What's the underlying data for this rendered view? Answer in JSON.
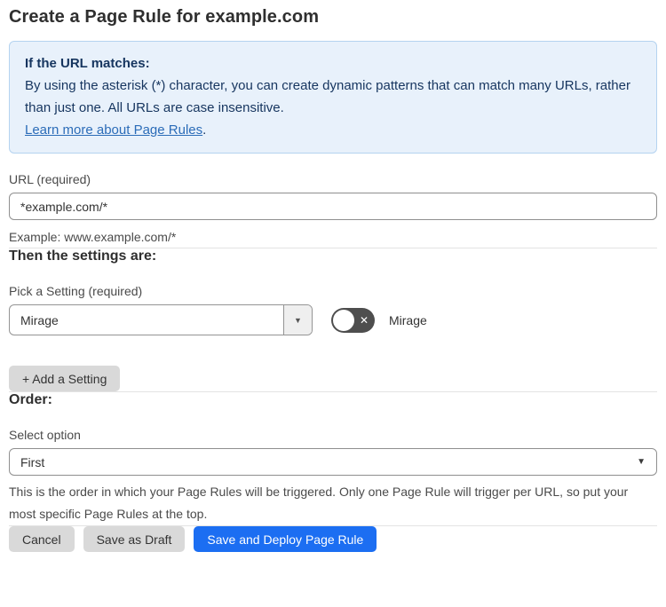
{
  "page": {
    "title": "Create a Page Rule for example.com"
  },
  "info_box": {
    "heading": "If the URL matches:",
    "body": "By using the asterisk (*) character, you can create dynamic patterns that can match many URLs, rather than just one. All URLs are case insensitive.",
    "link_text": "Learn more about Page Rules",
    "link_suffix": "."
  },
  "url_field": {
    "label": "URL (required)",
    "value": "*example.com/*",
    "helper": "Example: www.example.com/*"
  },
  "settings_section": {
    "heading": "Then the settings are:",
    "setting_label": "Pick a Setting (required)",
    "setting_value": "Mirage",
    "toggle_label": "Mirage",
    "toggle_state": "off",
    "add_setting_label": "+ Add a Setting"
  },
  "order_section": {
    "heading": "Order:",
    "label": "Select option",
    "value": "First",
    "helper": "This is the order in which your Page Rules will be triggered. Only one Page Rule will trigger per URL, so put your most specific Page Rules at the top."
  },
  "footer": {
    "cancel_label": "Cancel",
    "save_draft_label": "Save as Draft",
    "save_deploy_label": "Save and Deploy Page Rule"
  },
  "icons": {
    "dropdown_arrow": "▼",
    "toggle_off_x": "✕"
  },
  "colors": {
    "accent_blue": "#1c6ef2",
    "info_bg": "#e8f1fb",
    "info_border": "#b5d3f0",
    "info_text": "#16355f",
    "link_blue": "#2b6cb8",
    "toggle_off_bg": "#4e4e4e",
    "button_gray": "#d9d9d9"
  }
}
